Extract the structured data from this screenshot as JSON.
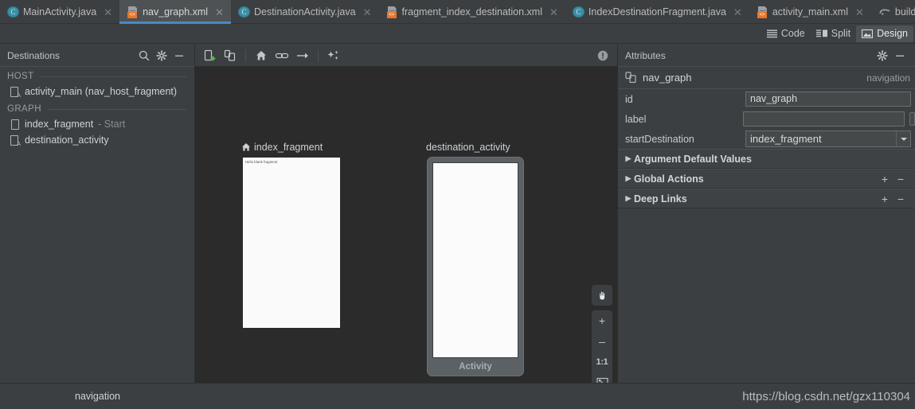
{
  "tabs": [
    {
      "label": "MainActivity.java",
      "icon": "java-class-icon",
      "active": false,
      "closable": true
    },
    {
      "label": "nav_graph.xml",
      "icon": "xml-layout-icon",
      "active": true,
      "closable": true
    },
    {
      "label": "DestinationActivity.java",
      "icon": "java-class-icon",
      "active": false,
      "closable": true
    },
    {
      "label": "fragment_index_destination.xml",
      "icon": "xml-layout-icon",
      "active": false,
      "closable": true
    },
    {
      "label": "IndexDestinationFragment.java",
      "icon": "java-class-icon",
      "active": false,
      "closable": true
    },
    {
      "label": "activity_main.xml",
      "icon": "xml-layout-icon",
      "active": false,
      "closable": true
    },
    {
      "label": "build.gradle (:app)",
      "icon": "gradle-icon",
      "active": false,
      "closable": true
    }
  ],
  "editor_modes": [
    {
      "label": "Code",
      "icon": "code-lines-icon",
      "selected": false
    },
    {
      "label": "Split",
      "icon": "split-view-icon",
      "selected": false
    },
    {
      "label": "Design",
      "icon": "design-image-icon",
      "selected": true
    }
  ],
  "destinations_panel": {
    "title": "Destinations",
    "header_icons": [
      "search-icon",
      "gear-icon",
      "minimize-icon"
    ],
    "sections": [
      {
        "title": "HOST",
        "items": [
          {
            "label": "activity_main (nav_host_fragment)",
            "icon": "activity-icon",
            "suffix": ""
          }
        ]
      },
      {
        "title": "GRAPH",
        "items": [
          {
            "label": "index_fragment",
            "icon": "fragment-icon",
            "suffix": "- Start"
          },
          {
            "label": "destination_activity",
            "icon": "activity-icon",
            "suffix": ""
          }
        ]
      }
    ]
  },
  "canvas_toolbar": {
    "buttons": [
      "new-destination-icon",
      "nested-graph-icon",
      "set-start-destination-icon",
      "add-deep-link-icon",
      "add-action-icon",
      "auto-arrange-icon"
    ],
    "status_icon": "warning-issue-icon"
  },
  "canvas": {
    "nodes": [
      {
        "name": "index_fragment",
        "type": "fragment",
        "is_start": true,
        "start_icon": "home-icon",
        "preview_text": "Hello blank fragment"
      },
      {
        "name": "destination_activity",
        "type": "activity",
        "is_start": false,
        "footer_label": "Activity"
      }
    ],
    "zoom_controls": [
      {
        "name": "pan-tool-button",
        "glyph": "pan-hand-icon"
      },
      {
        "name": "zoom-in-button",
        "glyph": "+"
      },
      {
        "name": "zoom-out-button",
        "glyph": "–"
      },
      {
        "name": "zoom-actual-size-button",
        "glyph": "1:1"
      },
      {
        "name": "zoom-to-fit-button",
        "glyph": "fit-screen-icon"
      }
    ]
  },
  "attributes_panel": {
    "title": "Attributes",
    "header_icons": [
      "gear-icon",
      "minimize-icon"
    ],
    "object": {
      "name": "nav_graph",
      "icon": "navigation-graph-icon",
      "type": "navigation"
    },
    "fields": [
      {
        "key": "id",
        "value": "nav_graph",
        "placeholder": "",
        "control": "text"
      },
      {
        "key": "label",
        "value": "",
        "placeholder": "",
        "control": "text-with-button"
      },
      {
        "key": "startDestination",
        "value": "index_fragment",
        "placeholder": "",
        "control": "combo"
      }
    ],
    "sections": [
      {
        "label": "Argument Default Values",
        "expanded": false,
        "has_add": false,
        "has_remove": false
      },
      {
        "label": "Global Actions",
        "expanded": false,
        "has_add": true,
        "has_remove": true
      },
      {
        "label": "Deep Links",
        "expanded": false,
        "has_add": true,
        "has_remove": true
      }
    ]
  },
  "status_bar": {
    "left_label": "navigation",
    "watermark": "https://blog.csdn.net/gzx110304"
  },
  "colors": {
    "background": "#3c3f41",
    "canvas": "#2b2b2b",
    "accent_blue": "#4a88c7",
    "xml_badge_orange": "#e8762c",
    "java_icon_teal": "#3b8ea5",
    "start_green": "#4caf50",
    "text_primary": "#cfd2d4",
    "text_muted": "#9a9d9f"
  }
}
